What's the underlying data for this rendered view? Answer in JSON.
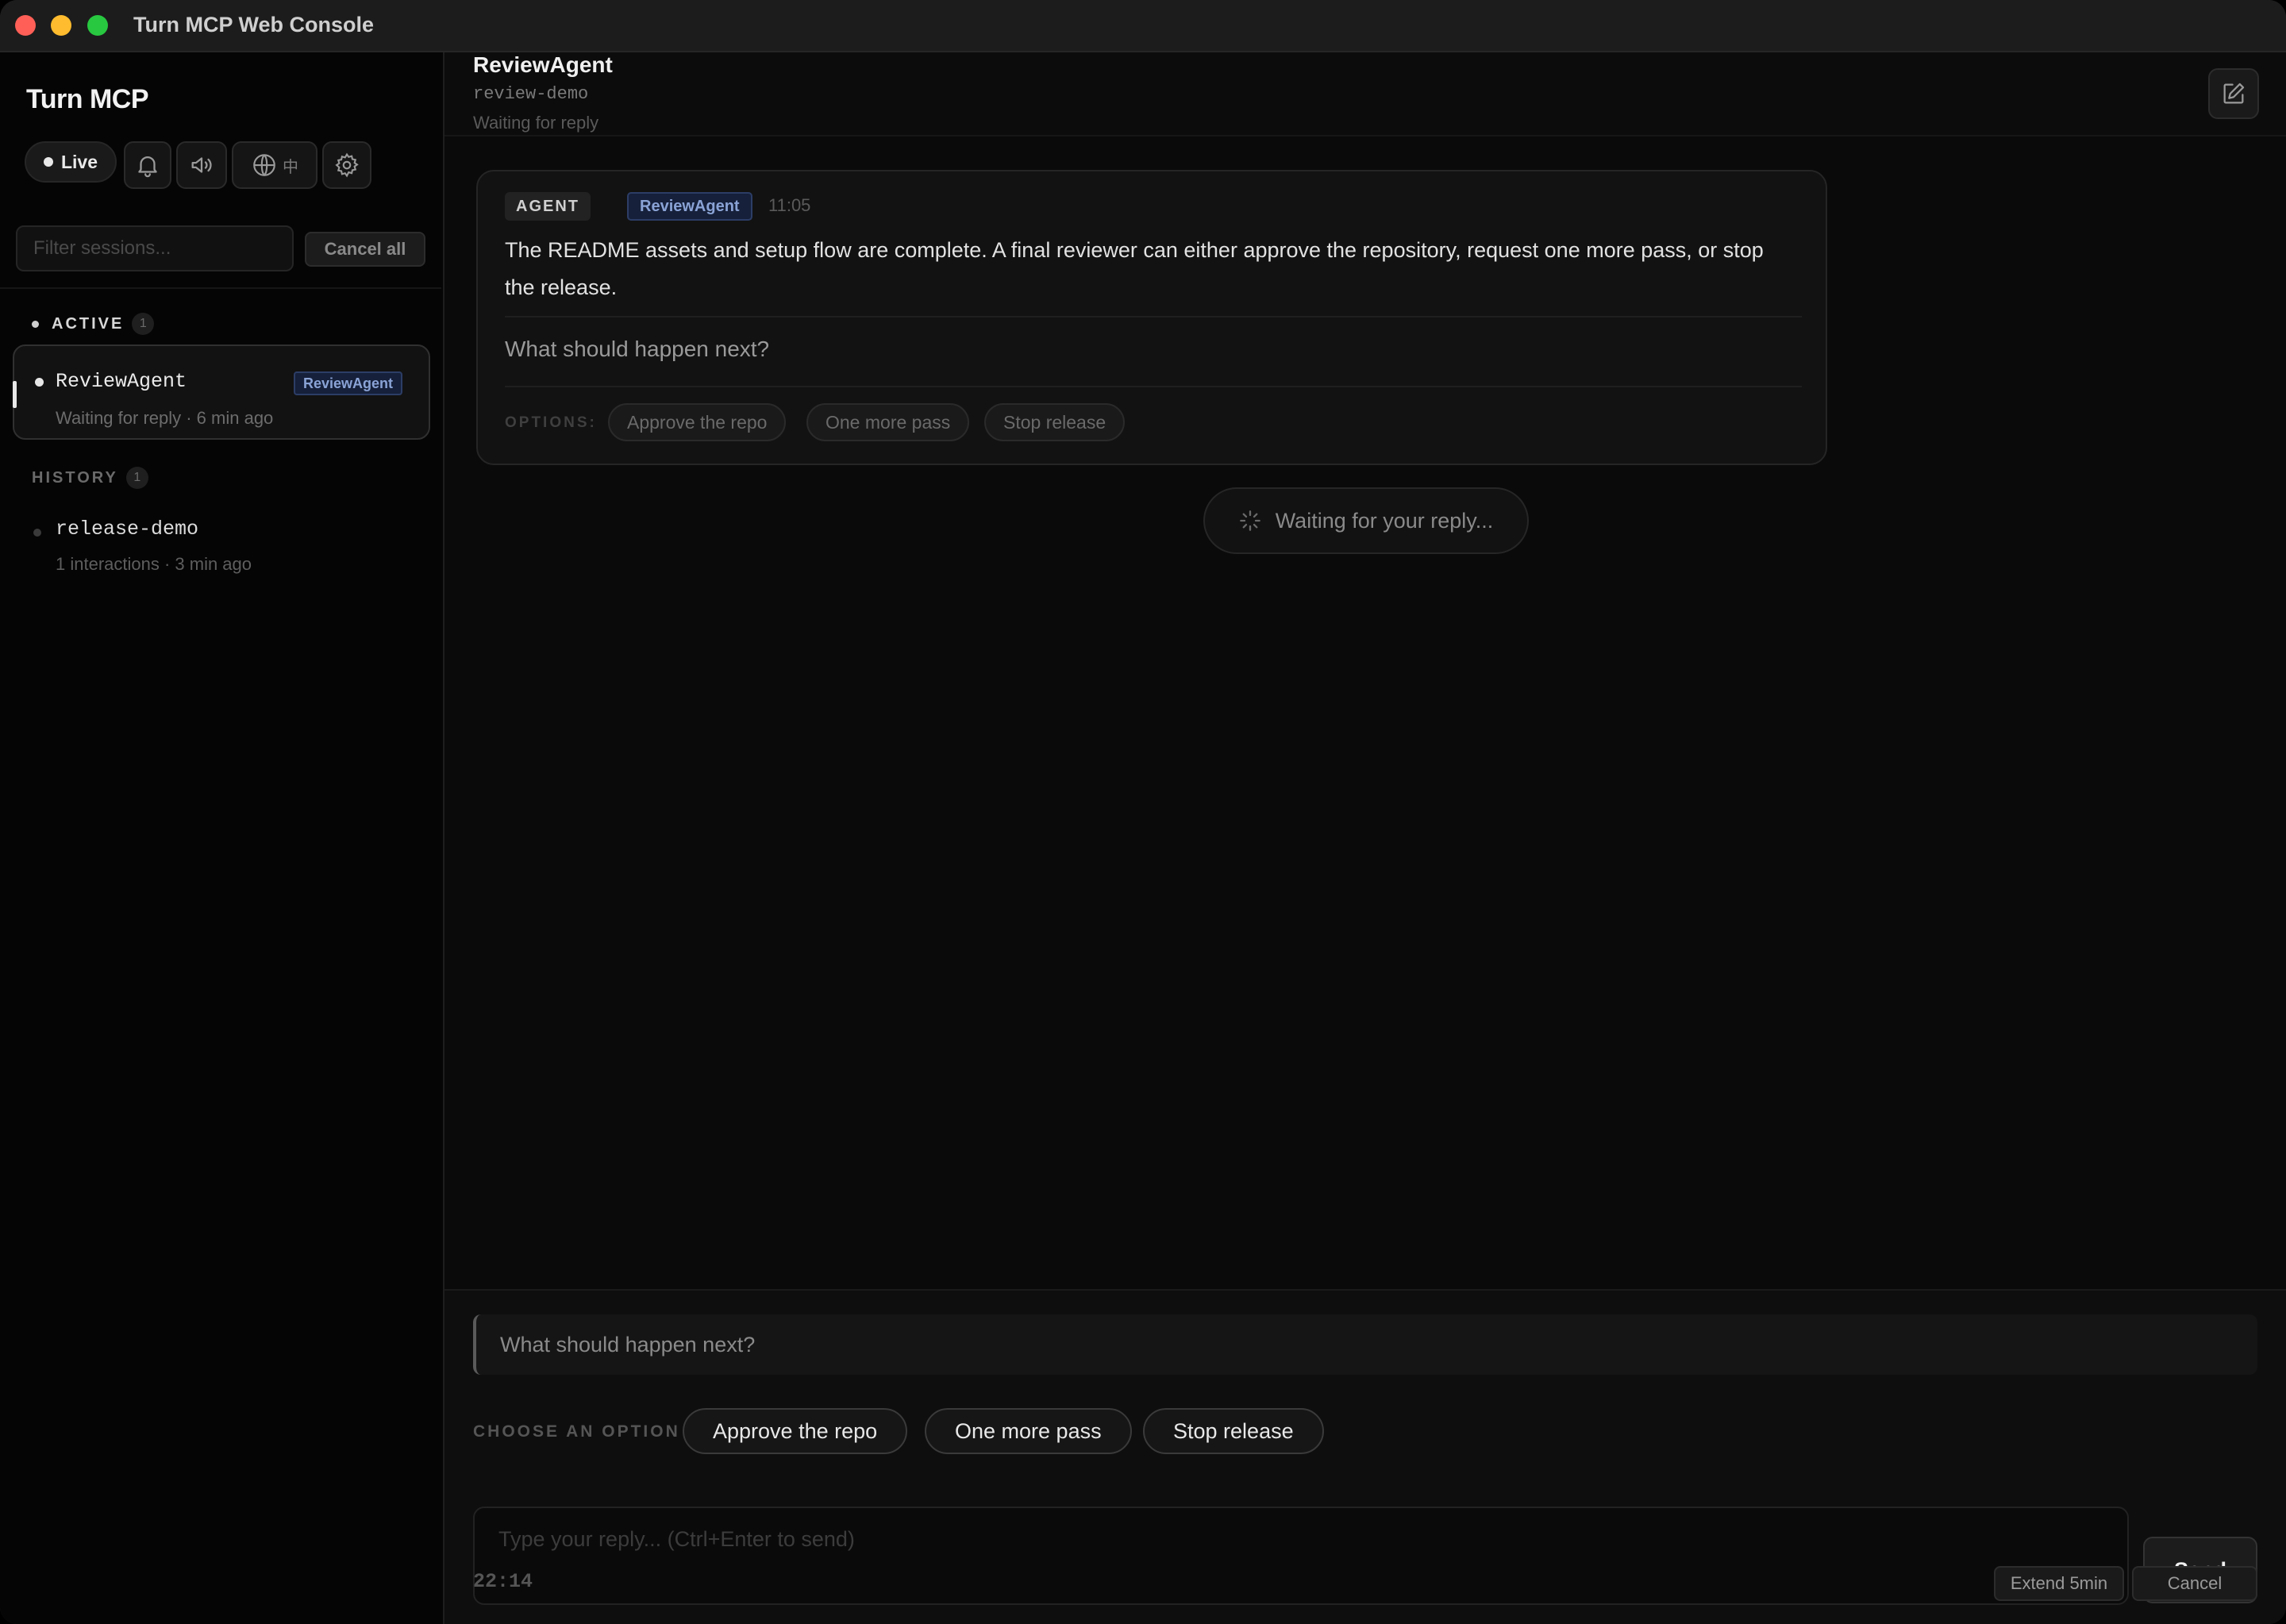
{
  "window": {
    "title": "Turn MCP Web Console"
  },
  "sidebar": {
    "brand": "Turn MCP",
    "status": "Live",
    "language_label": "中",
    "filter_placeholder": "Filter sessions...",
    "cancel_all": "Cancel all",
    "active": {
      "label": "ACTIVE",
      "count": "1",
      "sessions": [
        {
          "name": "ReviewAgent",
          "tag": "ReviewAgent",
          "sub": "Waiting for reply · 6 min ago"
        }
      ]
    },
    "history": {
      "label": "HISTORY",
      "count": "1",
      "sessions": [
        {
          "name": "release-demo",
          "sub": "1 interactions · 3 min ago"
        }
      ]
    }
  },
  "main": {
    "header": {
      "title": "ReviewAgent",
      "session_id": "review-demo",
      "status": "Waiting for reply"
    },
    "message": {
      "role": "AGENT",
      "agent": "ReviewAgent",
      "time": "11:05",
      "body": "The README assets and setup flow are complete. A final reviewer can either approve the repository, request one more pass, or stop the release.",
      "question": "What should happen next?",
      "options_label": "OPTIONS:",
      "options": [
        "Approve the repo",
        "One more pass",
        "Stop release"
      ]
    },
    "waiting": "Waiting for your reply..."
  },
  "composer": {
    "prompt": "What should happen next?",
    "choose_label": "CHOOSE AN OPTION",
    "choices": [
      "Approve the repo",
      "One more pass",
      "Stop release"
    ],
    "reply_placeholder": "Type your reply... (Ctrl+Enter to send)",
    "send": "Send",
    "timer": "22:14",
    "extend": "Extend 5min",
    "cancel": "Cancel"
  },
  "icons": [
    "bell-icon",
    "speaker-icon",
    "globe-icon",
    "gear-icon",
    "edit-icon",
    "spinner-icon"
  ]
}
